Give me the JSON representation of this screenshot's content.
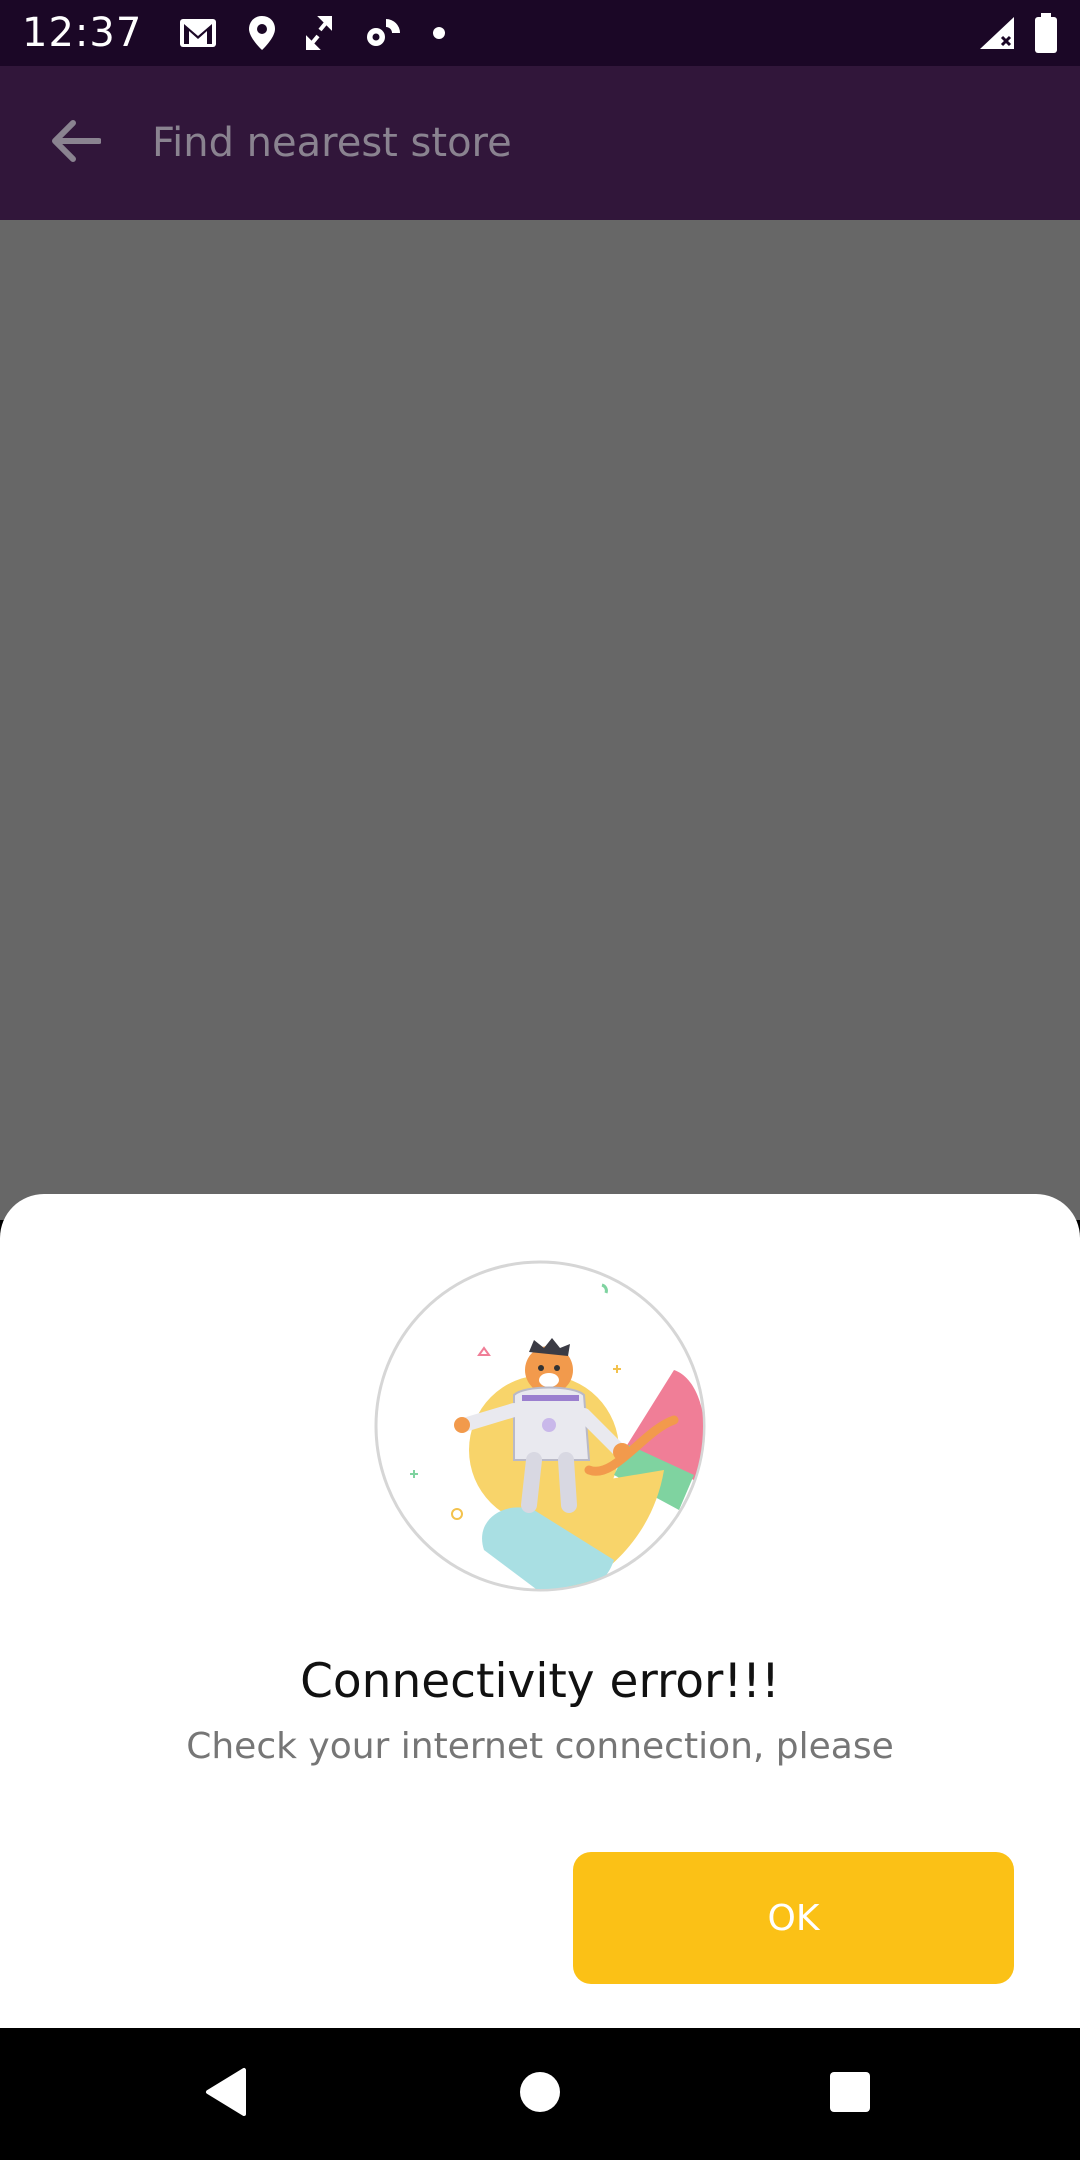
{
  "status_bar": {
    "time": "12:37",
    "icons": [
      "gmail-icon",
      "location-icon",
      "transfer-icon",
      "settings-sync-icon",
      "dot-icon"
    ],
    "right_icons": [
      "signal-icon",
      "battery-icon"
    ]
  },
  "app_bar": {
    "title": "Find nearest store",
    "back_icon": "arrow-back-icon"
  },
  "dialog": {
    "illustration": "tiger-astronaut-illustration",
    "title": "Connectivity error!!!",
    "subtitle": "Check your internet connection, please",
    "ok_label": "OK"
  },
  "nav_bar": {
    "buttons": [
      "back-triangle-icon",
      "home-circle-icon",
      "recents-square-icon"
    ]
  },
  "colors": {
    "status_bar": "#1b0726",
    "app_bar": "#31163a",
    "scrim": "#676767",
    "ok_button": "#fbc116"
  }
}
